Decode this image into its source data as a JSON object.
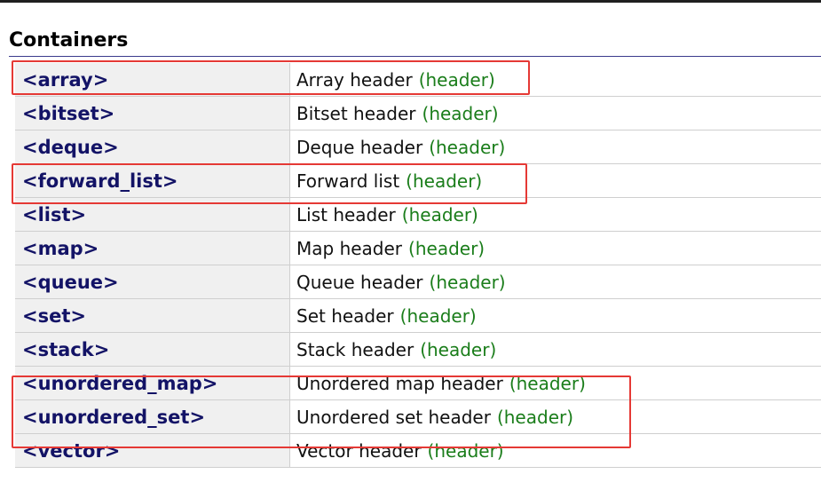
{
  "section": {
    "title": "Containers"
  },
  "tag_label": "(header)",
  "rows": [
    {
      "name": "<array>",
      "desc": "Array header",
      "tag": "(header)"
    },
    {
      "name": "<bitset>",
      "desc": "Bitset header",
      "tag": "(header)"
    },
    {
      "name": "<deque>",
      "desc": "Deque header",
      "tag": "(header)"
    },
    {
      "name": "<forward_list>",
      "desc": "Forward list",
      "tag": "(header)"
    },
    {
      "name": "<list>",
      "desc": "List header",
      "tag": "(header)"
    },
    {
      "name": "<map>",
      "desc": "Map header",
      "tag": "(header)"
    },
    {
      "name": "<queue>",
      "desc": "Queue header",
      "tag": "(header)"
    },
    {
      "name": "<set>",
      "desc": "Set header",
      "tag": "(header)"
    },
    {
      "name": "<stack>",
      "desc": "Stack header",
      "tag": "(header)"
    },
    {
      "name": "<unordered_map>",
      "desc": "Unordered map header",
      "tag": "(header)"
    },
    {
      "name": "<unordered_set>",
      "desc": "Unordered set header",
      "tag": "(header)"
    },
    {
      "name": "<vector>",
      "desc": "Vector header",
      "tag": "(header)"
    }
  ],
  "colors": {
    "name_text": "#131366",
    "tag_text": "#1a7d1a",
    "highlight": "#e53935",
    "name_cell_bg": "#f0f0f0"
  }
}
